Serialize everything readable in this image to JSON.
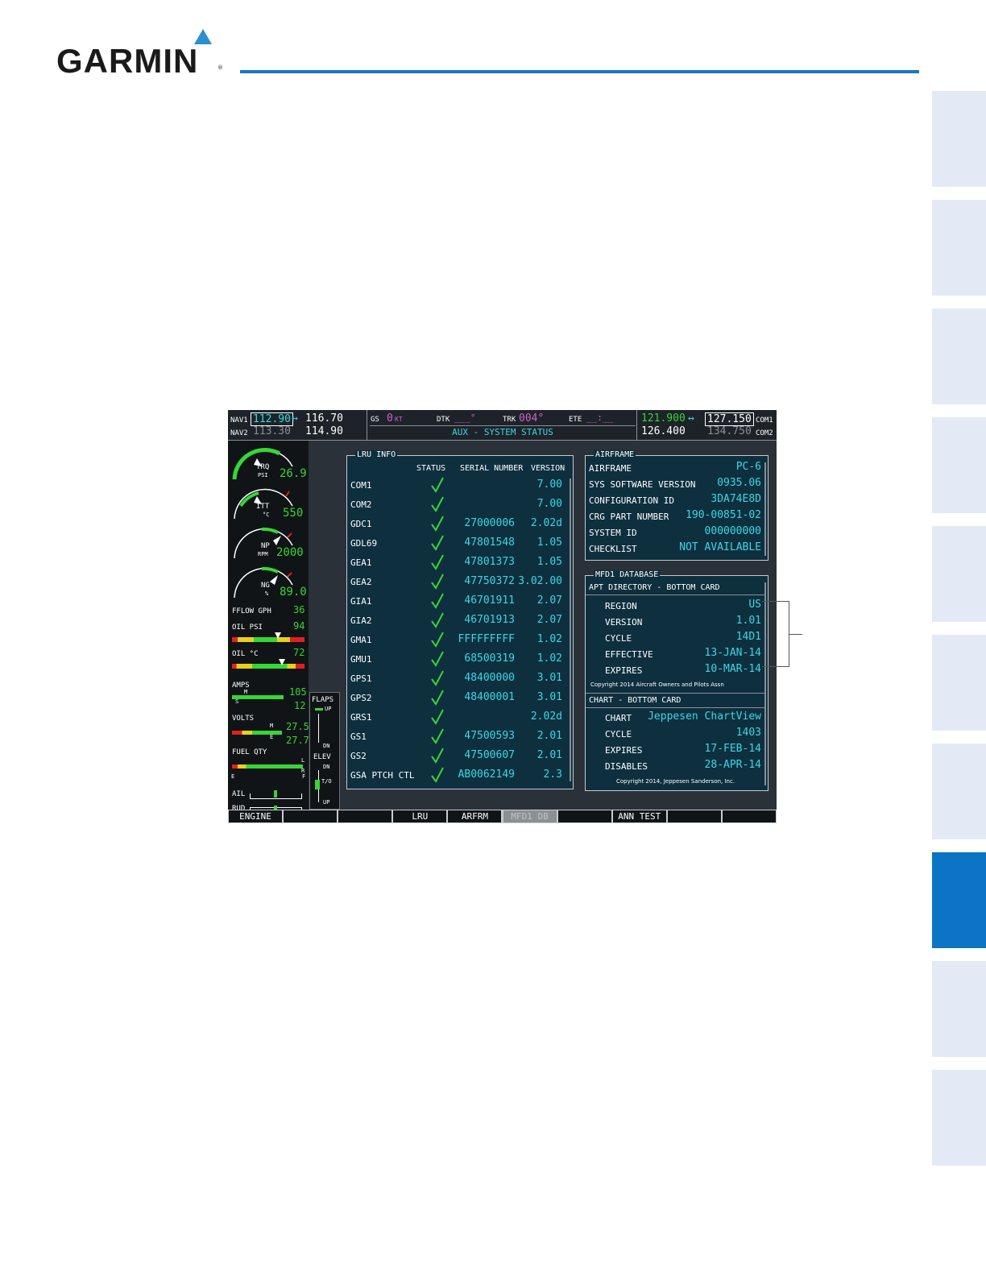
{
  "brand": {
    "name": "GARMIN",
    "reg": "®"
  },
  "colors": {
    "accent": "#1877c2",
    "tab": "#e4eaf5",
    "tab_active": "#0b74c4",
    "screen_value": "#38d8e8",
    "screen_green": "#36d636"
  },
  "top_bar": {
    "nav1_label": "NAV1",
    "nav1_active": "112.90",
    "nav1_swap": "↔",
    "nav1_standby": "116.70",
    "nav2_label": "NAV2",
    "nav2_active": "113.30",
    "nav2_standby": "114.90",
    "gs_label": "GS",
    "gs_value": "0",
    "gs_unit": "KT",
    "dtk_label": "DTK",
    "dtk_value": "___°",
    "trk_label": "TRK",
    "trk_value": "004°",
    "ete_label": "ETE",
    "ete_value": "__:__",
    "page_title": "AUX - SYSTEM STATUS",
    "com1_active": "121.900",
    "com1_swap": "↔",
    "com1_standby": "127.150",
    "com1_label": "COM1",
    "com2_active": "126.400",
    "com2_standby": "134.750",
    "com2_label": "COM2"
  },
  "engine": {
    "trq_label": "TRQ",
    "trq_unit": "PSI",
    "trq_value": "26.9",
    "itt_label": "ITT",
    "itt_unit": "°C",
    "itt_value": "550",
    "np_label": "NP",
    "np_unit": "RPM",
    "np_value": "2000",
    "ng_label": "NG",
    "ng_unit": "%",
    "ng_value": "89.0",
    "fflow_label": "FFLOW GPH",
    "fflow_value": "36",
    "oil_psi_label": "OIL PSI",
    "oil_psi_value": "94",
    "oil_c_label": "OIL °C",
    "oil_c_value": "72",
    "amps_label": "AMPS",
    "amps_m": "M",
    "amps_s": "S",
    "amps_value_1": "105",
    "amps_value_2": "12",
    "volts_label": "VOLTS",
    "volts_m": "M",
    "volts_e": "E",
    "volts_value_1": "27.5",
    "volts_value_2": "27.7",
    "fuel_label": "FUEL QTY",
    "fuel_l": "L",
    "fuel_r": "R",
    "fuel_e": "E",
    "fuel_f": "F",
    "ail_label": "AIL",
    "rud_label": "RUD"
  },
  "trim": {
    "flaps_label": "FLAPS",
    "flaps_up": "UP",
    "flaps_dn": "DN",
    "elev_label": "ELEV",
    "elev_dn": "DN",
    "elev_to": "T/O",
    "elev_up": "UP"
  },
  "lru_info": {
    "title": "LRU INFO",
    "headers": {
      "status": "STATUS",
      "serial": "SERIAL NUMBER",
      "version": "VERSION"
    },
    "rows": [
      {
        "name": "COM1",
        "serial": "",
        "version": "7.00"
      },
      {
        "name": "COM2",
        "serial": "",
        "version": "7.00"
      },
      {
        "name": "GDC1",
        "serial": "27000006",
        "version": "2.02d"
      },
      {
        "name": "GDL69",
        "serial": "47801548",
        "version": "1.05"
      },
      {
        "name": "GEA1",
        "serial": "47801373",
        "version": "1.05"
      },
      {
        "name": "GEA2",
        "serial": "47750372",
        "version": "3.02.00"
      },
      {
        "name": "GIA1",
        "serial": "46701911",
        "version": "2.07"
      },
      {
        "name": "GIA2",
        "serial": "46701913",
        "version": "2.07"
      },
      {
        "name": "GMA1",
        "serial": "FFFFFFFFF",
        "version": "1.02"
      },
      {
        "name": "GMU1",
        "serial": "68500319",
        "version": "1.02"
      },
      {
        "name": "GPS1",
        "serial": "48400000",
        "version": "3.01"
      },
      {
        "name": "GPS2",
        "serial": "48400001",
        "version": "3.01"
      },
      {
        "name": "GRS1",
        "serial": "",
        "version": "2.02d"
      },
      {
        "name": "GS1",
        "serial": "47500593",
        "version": "2.01"
      },
      {
        "name": "GS2",
        "serial": "47500607",
        "version": "2.01"
      },
      {
        "name": "GSA PTCH CTL",
        "serial": "AB0062149",
        "version": "2.3"
      }
    ]
  },
  "airframe": {
    "title": "AIRFRAME",
    "rows": [
      {
        "k": "AIRFRAME",
        "v": "PC-6"
      },
      {
        "k": "SYS SOFTWARE VERSION",
        "v": "0935.06"
      },
      {
        "k": "CONFIGURATION ID",
        "v": "3DA74E8D"
      },
      {
        "k": "CRG PART NUMBER",
        "v": "190-00851-02"
      },
      {
        "k": "SYSTEM ID",
        "v": "000000000"
      },
      {
        "k": "CHECKLIST",
        "v": "NOT AVAILABLE"
      }
    ]
  },
  "mfd1_database": {
    "title": "MFD1 DATABASE",
    "apt_header": "APT DIRECTORY - BOTTOM CARD",
    "apt_rows": [
      {
        "k": "REGION",
        "v": "US"
      },
      {
        "k": "VERSION",
        "v": "1.01"
      },
      {
        "k": "CYCLE",
        "v": "14D1"
      },
      {
        "k": "EFFECTIVE",
        "v": "13-JAN-14"
      },
      {
        "k": "EXPIRES",
        "v": "10-MAR-14"
      }
    ],
    "apt_copyright": "Copyright 2014 Aircraft Owners and Pilots Assn",
    "chart_header": "CHART - BOTTOM CARD",
    "chart_rows": [
      {
        "k": "CHART",
        "v": "Jeppesen ChartView"
      },
      {
        "k": "CYCLE",
        "v": "1403"
      },
      {
        "k": "EXPIRES",
        "v": "17-FEB-14"
      },
      {
        "k": "DISABLES",
        "v": "28-APR-14"
      }
    ],
    "chart_copyright": "Copyright 2014, Jeppesen Sanderson, Inc."
  },
  "softkeys": [
    "ENGINE",
    "",
    "",
    "LRU",
    "ARFRM",
    "MFD1 DB",
    "",
    "ANN TEST",
    "",
    ""
  ]
}
